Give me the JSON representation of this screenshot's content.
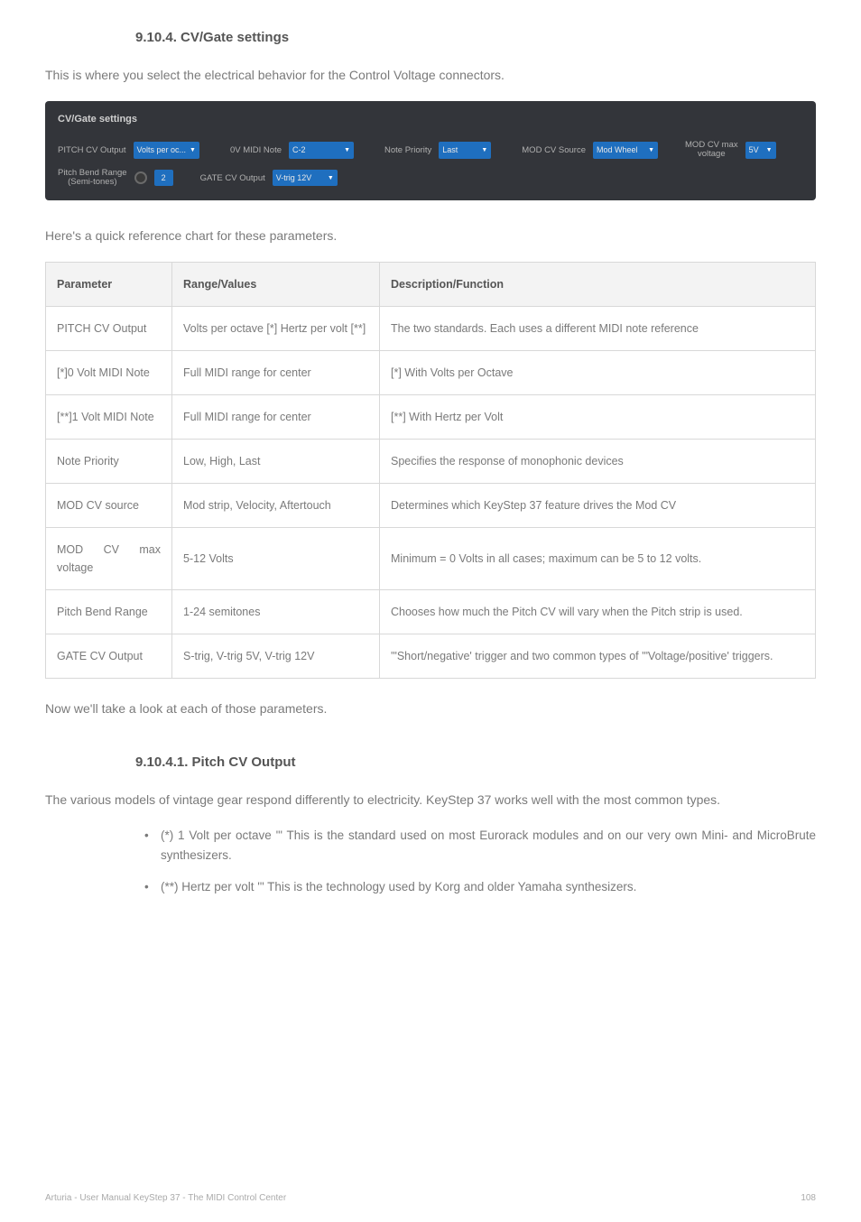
{
  "headings": {
    "section": "9.10.4. CV/Gate settings",
    "intro": "This is where you select the electrical behavior for the Control Voltage connectors.",
    "refChart": "Here's a quick reference chart for these parameters.",
    "afterTable": "Now we'll take a look at each of those parameters.",
    "subsection": "9.10.4.1. Pitch CV Output",
    "subIntro": "The various models of vintage gear respond differently to electricity. KeyStep 37 works well with the most common types."
  },
  "cvPanel": {
    "title": "CV/Gate settings",
    "row1": {
      "pitchCvOutput": {
        "label": "PITCH CV Output",
        "value": "Volts per oc..."
      },
      "zeroVMidiNote": {
        "label": "0V MIDI Note",
        "value": "C-2"
      },
      "notePriority": {
        "label": "Note Priority",
        "value": "Last"
      },
      "modCvSource": {
        "label": "MOD CV Source",
        "value": "Mod Wheel"
      },
      "modCvMaxVoltage": {
        "label": "MOD CV max\nvoltage",
        "value": "5V"
      }
    },
    "row2": {
      "pitchBendRange": {
        "label": "Pitch Bend Range\n(Semi-tones)",
        "value": "2"
      },
      "gateCvOutput": {
        "label": "GATE CV Output",
        "value": "V-trig 12V"
      }
    }
  },
  "table": {
    "headers": {
      "c1": "Parameter",
      "c2": "Range/Values",
      "c3": "Description/Function"
    },
    "rows": [
      {
        "c1": "PITCH CV Output",
        "c2": "Volts per octave [*] Hertz per volt [**]",
        "c3": "The two standards. Each uses a different MIDI note reference"
      },
      {
        "c1": "[*]0 Volt MIDI Note",
        "c2": "Full MIDI range for center",
        "c3": "[*] With Volts per Octave"
      },
      {
        "c1": "[**]1 Volt MIDI Note",
        "c2": "Full MIDI range for center",
        "c3": "[**] With Hertz per Volt"
      },
      {
        "c1": "Note Priority",
        "c2": "Low, High, Last",
        "c3": "Specifies the response of monophonic devices"
      },
      {
        "c1": "MOD CV source",
        "c2": "Mod strip, Velocity, Aftertouch",
        "c3": "Determines which KeyStep 37 feature drives the Mod CV"
      },
      {
        "c1": "MOD CV max voltage",
        "c2": "5-12 Volts",
        "c3": "Minimum = 0 Volts in all cases; maximum can be 5 to 12 volts."
      },
      {
        "c1": "Pitch Bend Range",
        "c2": "1-24 semitones",
        "c3": "Chooses how much the Pitch CV will vary when the Pitch strip is used."
      },
      {
        "c1": "GATE CV Output",
        "c2": "S-trig, V-trig 5V, V-trig 12V",
        "c3": "'\"Short/negative' trigger and two common types of '\"Voltage/positive' triggers."
      }
    ]
  },
  "bullets": [
    "(*) 1 Volt per octave '\" This is the standard used on most Eurorack modules and on our very own Mini- and MicroBrute synthesizers.",
    "(**) Hertz per volt '\" This is the technology used by Korg and older Yamaha synthesizers."
  ],
  "footer": {
    "left": "Arturia - User Manual KeyStep 37 - The MIDI Control Center",
    "right": "108"
  }
}
